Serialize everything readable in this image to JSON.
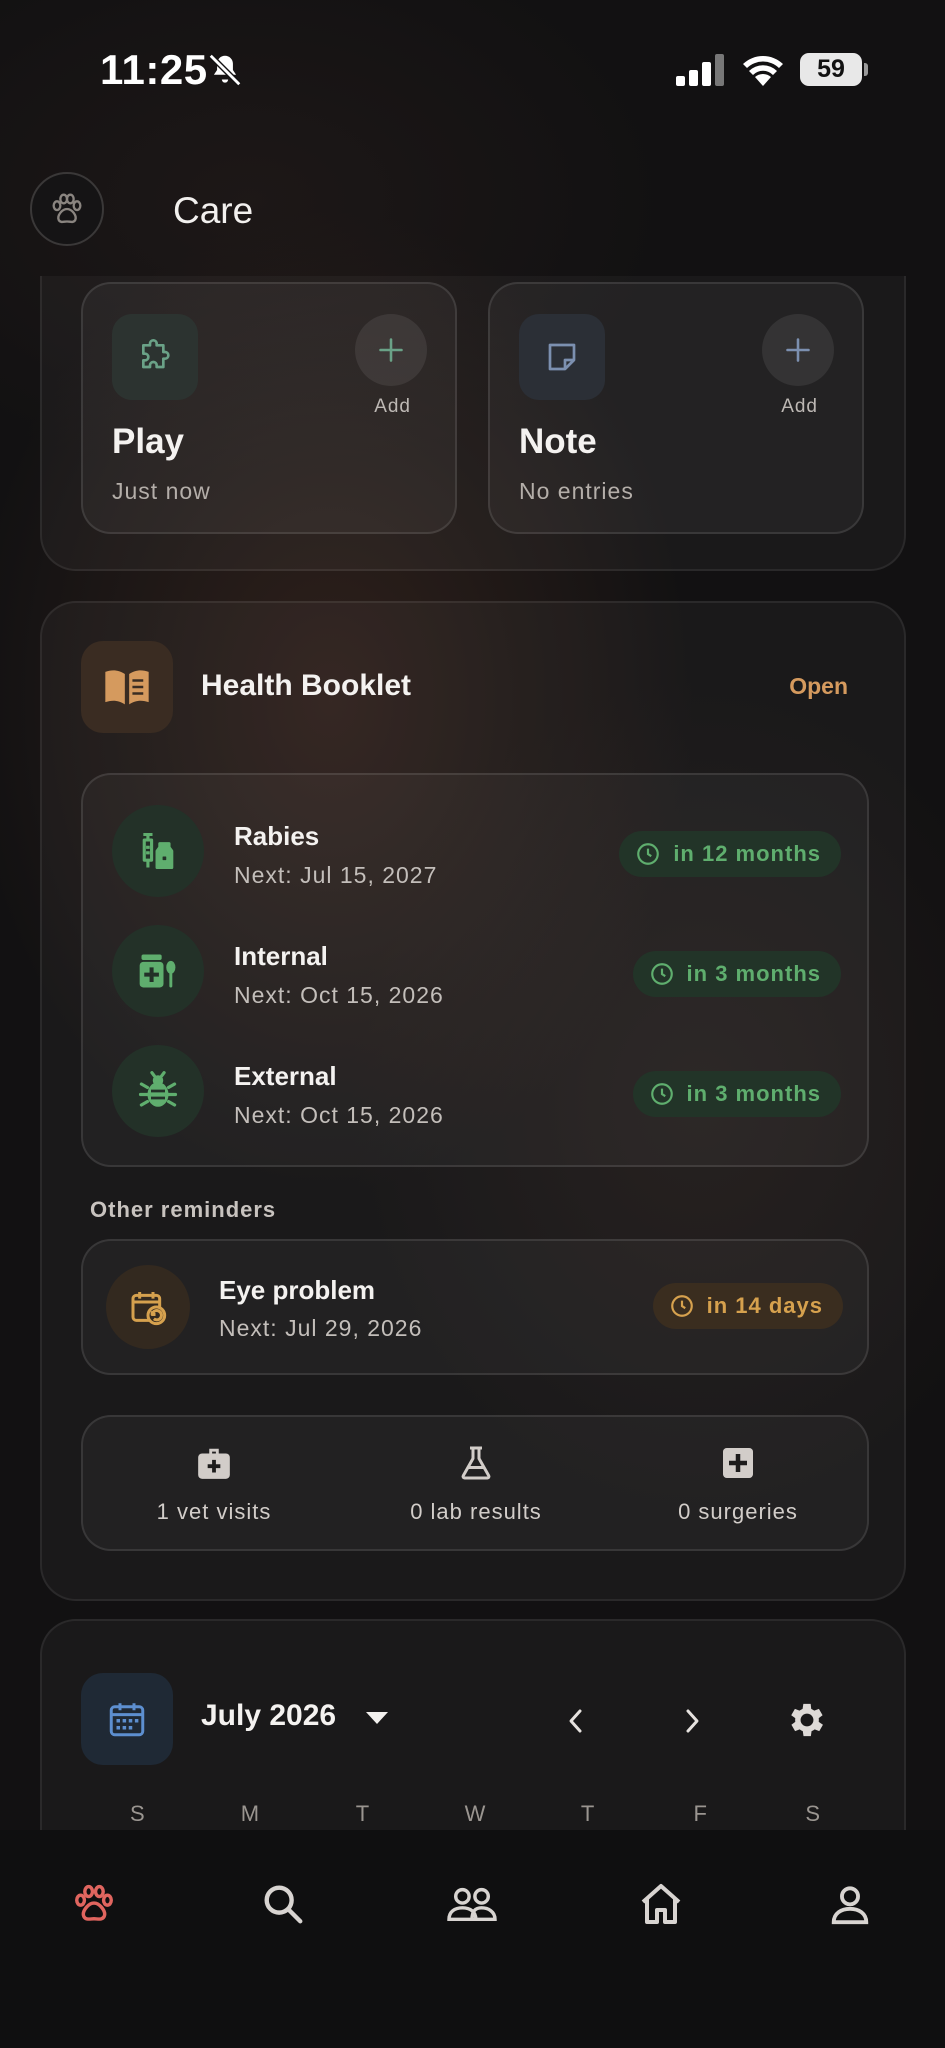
{
  "status_bar": {
    "time": "11:25",
    "battery": "59"
  },
  "header": {
    "title": "Care"
  },
  "quick_cards": [
    {
      "title": "Play",
      "subtitle": "Just now",
      "add_label": "Add",
      "icon": "puzzle-icon"
    },
    {
      "title": "Note",
      "subtitle": "No entries",
      "add_label": "Add",
      "icon": "note-icon"
    }
  ],
  "health_booklet": {
    "title": "Health Booklet",
    "open_label": "Open",
    "vaccinations": [
      {
        "name": "Rabies",
        "next": "Next: Jul 15, 2027",
        "due": "in 12 months",
        "icon": "vaccine-icon"
      },
      {
        "name": "Internal",
        "next": "Next: Oct 15, 2026",
        "due": "in 3 months",
        "icon": "medicine-icon"
      },
      {
        "name": "External",
        "next": "Next: Oct 15, 2026",
        "due": "in 3 months",
        "icon": "bug-icon"
      }
    ],
    "other_label": "Other reminders",
    "reminder": {
      "name": "Eye problem",
      "next": "Next: Jul 29, 2026",
      "due": "in 14 days"
    },
    "stats": [
      {
        "label": "1 vet visits",
        "icon": "medkit-icon"
      },
      {
        "label": "0 lab results",
        "icon": "flask-icon"
      },
      {
        "label": "0 surgeries",
        "icon": "plus-box-icon"
      }
    ],
    "colors": {
      "green": "#5fae6e",
      "orange": "#d6a14e",
      "accent": "#d59a5e"
    }
  },
  "calendar": {
    "month": "July 2026",
    "weekdays": [
      "S",
      "M",
      "T",
      "W",
      "T",
      "F",
      "S"
    ]
  },
  "bottom_nav": [
    "paw-icon",
    "search-icon",
    "people-icon",
    "home-icon",
    "profile-icon"
  ]
}
